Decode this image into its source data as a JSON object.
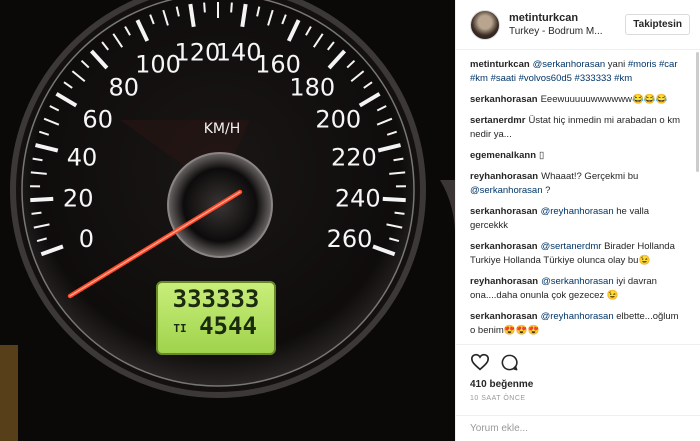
{
  "post": {
    "username": "metinturkcan",
    "location": "Turkey - Bodrum M...",
    "follow_label": "Takiptesin"
  },
  "photo": {
    "speeds": [
      "0",
      "20",
      "40",
      "60",
      "80",
      "100",
      "120",
      "140",
      "160",
      "180",
      "200",
      "220",
      "240",
      "260"
    ],
    "unit": "KM/H",
    "odometer": "333333",
    "trip_label": "TI",
    "trip": "4544"
  },
  "comments": [
    {
      "user": "metinturkcan",
      "parts": [
        {
          "t": "@serkanhorasan",
          "m": true
        },
        {
          "t": " yani "
        },
        {
          "t": "#moris #car #km #saati #volvos60d5 #333333 #km",
          "m": true
        }
      ]
    },
    {
      "user": "serkanhorasan",
      "parts": [
        {
          "t": "Eeewuuuuuwwwwww😂😂😂"
        }
      ]
    },
    {
      "user": "sertanerdmr",
      "parts": [
        {
          "t": "Üstat hiç inmedin mi arabadan o km nedir ya..."
        }
      ]
    },
    {
      "user": "egemenalkann",
      "parts": [
        {
          "t": "▯"
        }
      ]
    },
    {
      "user": "reyhanhorasan",
      "parts": [
        {
          "t": "Whaaat!? Gerçekmi bu "
        },
        {
          "t": "@serkanhorasan",
          "m": true
        },
        {
          "t": " ?"
        }
      ]
    },
    {
      "user": "serkanhorasan",
      "parts": [
        {
          "t": "@reyhanhorasan",
          "m": true
        },
        {
          "t": " he valla gercekkk"
        }
      ]
    },
    {
      "user": "serkanhorasan",
      "parts": [
        {
          "t": "@sertanerdmr",
          "m": true
        },
        {
          "t": " Birader Hollanda Turkiye Hollanda Türkiye olunca olay bu😉"
        }
      ]
    },
    {
      "user": "reyhanhorasan",
      "parts": [
        {
          "t": "@serkanhorasan",
          "m": true
        },
        {
          "t": " iyi davran ona....daha onunla çok gezecez 😉"
        }
      ]
    },
    {
      "user": "serkanhorasan",
      "parts": [
        {
          "t": "@reyhanhorasan",
          "m": true
        },
        {
          "t": " elbette...oğlum o benim😍😍😍"
        }
      ]
    }
  ],
  "actions": {
    "likes": "410 beğenme",
    "time_ago": "10 SAAT ÖNCE",
    "comment_placeholder": "Yorum ekle..."
  }
}
